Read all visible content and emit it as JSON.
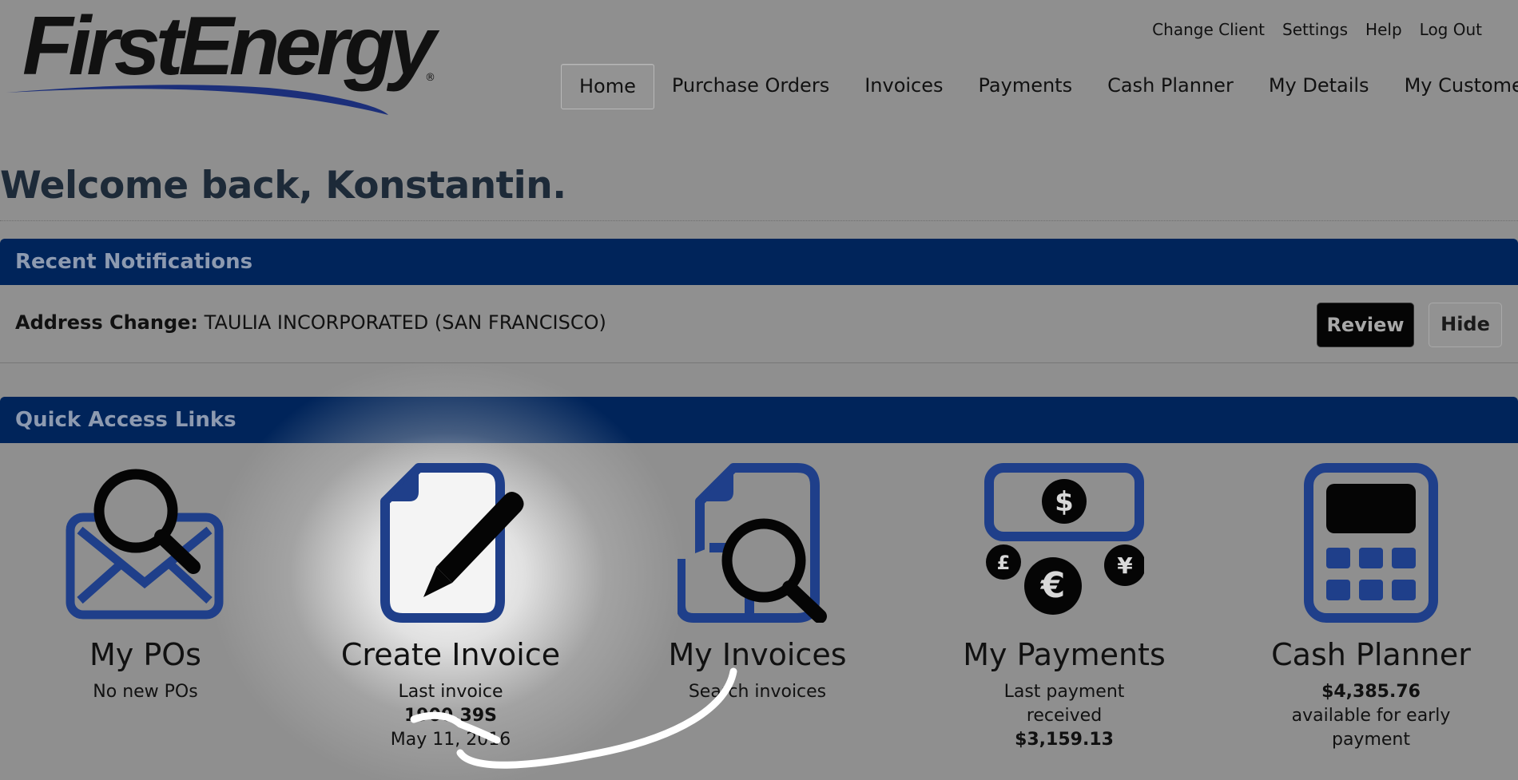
{
  "brand": {
    "logo_text": "FirstEnergy",
    "reg_mark": "®"
  },
  "util_nav": [
    "Change Client",
    "Settings",
    "Help",
    "Log Out"
  ],
  "main_nav": [
    {
      "label": "Home",
      "active": true
    },
    {
      "label": "Purchase Orders"
    },
    {
      "label": "Invoices"
    },
    {
      "label": "Payments"
    },
    {
      "label": "Cash Planner"
    },
    {
      "label": "My Details"
    },
    {
      "label": "My Customer"
    }
  ],
  "welcome": "Welcome back, Konstantin.",
  "notifications": {
    "header": "Recent Notifications",
    "item_label": "Address Change:",
    "item_value": "TAULIA INCORPORATED (SAN FRANCISCO)",
    "review_label": "Review",
    "hide_label": "Hide"
  },
  "quick_access": {
    "header": "Quick Access Links",
    "tiles": [
      {
        "title": "My POs",
        "line1": "No new POs",
        "icon": "envelope-search-icon"
      },
      {
        "title": "Create Invoice",
        "line1": "Last invoice",
        "line2": "1900.39S",
        "line3": "May 11, 2016",
        "icon": "document-pen-icon"
      },
      {
        "title": "My Invoices",
        "line1": "Search invoices",
        "icon": "document-search-icon"
      },
      {
        "title": "My Payments",
        "line1": "Last payment",
        "line2": "received",
        "line3": "$3,159.13",
        "icon": "currency-icon"
      },
      {
        "title": "Cash Planner",
        "line1": "$4,385.76",
        "line2": "available for early",
        "line3": "payment",
        "icon": "calculator-icon"
      }
    ]
  },
  "colors": {
    "header_blue": "#00245a",
    "icon_blue": "#1f3f8a",
    "background": "#8f8f8f"
  }
}
